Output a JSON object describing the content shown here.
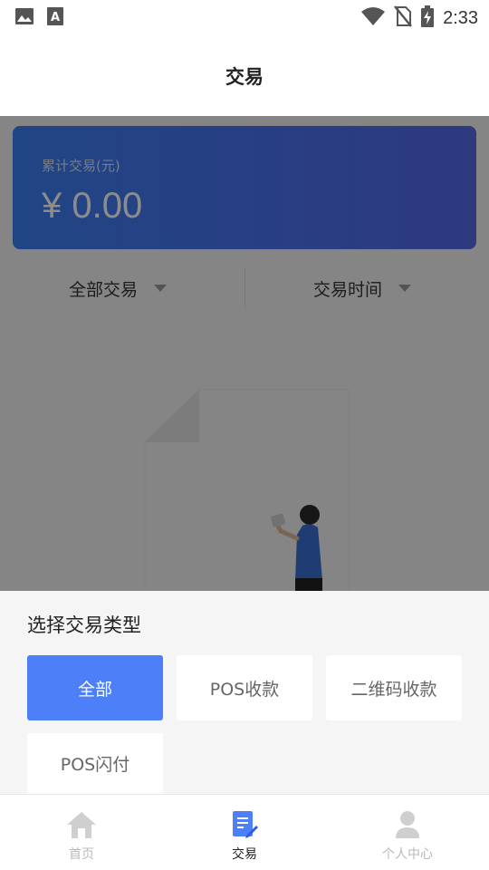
{
  "status_bar": {
    "time": "2:33",
    "left_icons": [
      "image-icon",
      "text-a-icon"
    ],
    "right_icons": [
      "wifi-icon",
      "no-sim-icon",
      "battery-charging-icon"
    ]
  },
  "header": {
    "title": "交易"
  },
  "summary": {
    "label": "累计交易(元)",
    "amount": "¥ 0.00",
    "gradient_colors": [
      "#3b7ff0",
      "#5569e6"
    ]
  },
  "filters": {
    "type_label": "全部交易",
    "time_label": "交易时间"
  },
  "sheet": {
    "title": "选择交易类型",
    "options": [
      {
        "label": "全部",
        "selected": true
      },
      {
        "label": "POS收款",
        "selected": false
      },
      {
        "label": "二维码收款",
        "selected": false
      },
      {
        "label": "POS闪付",
        "selected": false
      }
    ],
    "accent_color": "#4d7ff9"
  },
  "tabbar": {
    "tabs": [
      {
        "label": "首页",
        "icon": "home-icon",
        "active": false
      },
      {
        "label": "交易",
        "icon": "document-edit-icon",
        "active": true
      },
      {
        "label": "个人中心",
        "icon": "person-icon",
        "active": false
      }
    ]
  }
}
